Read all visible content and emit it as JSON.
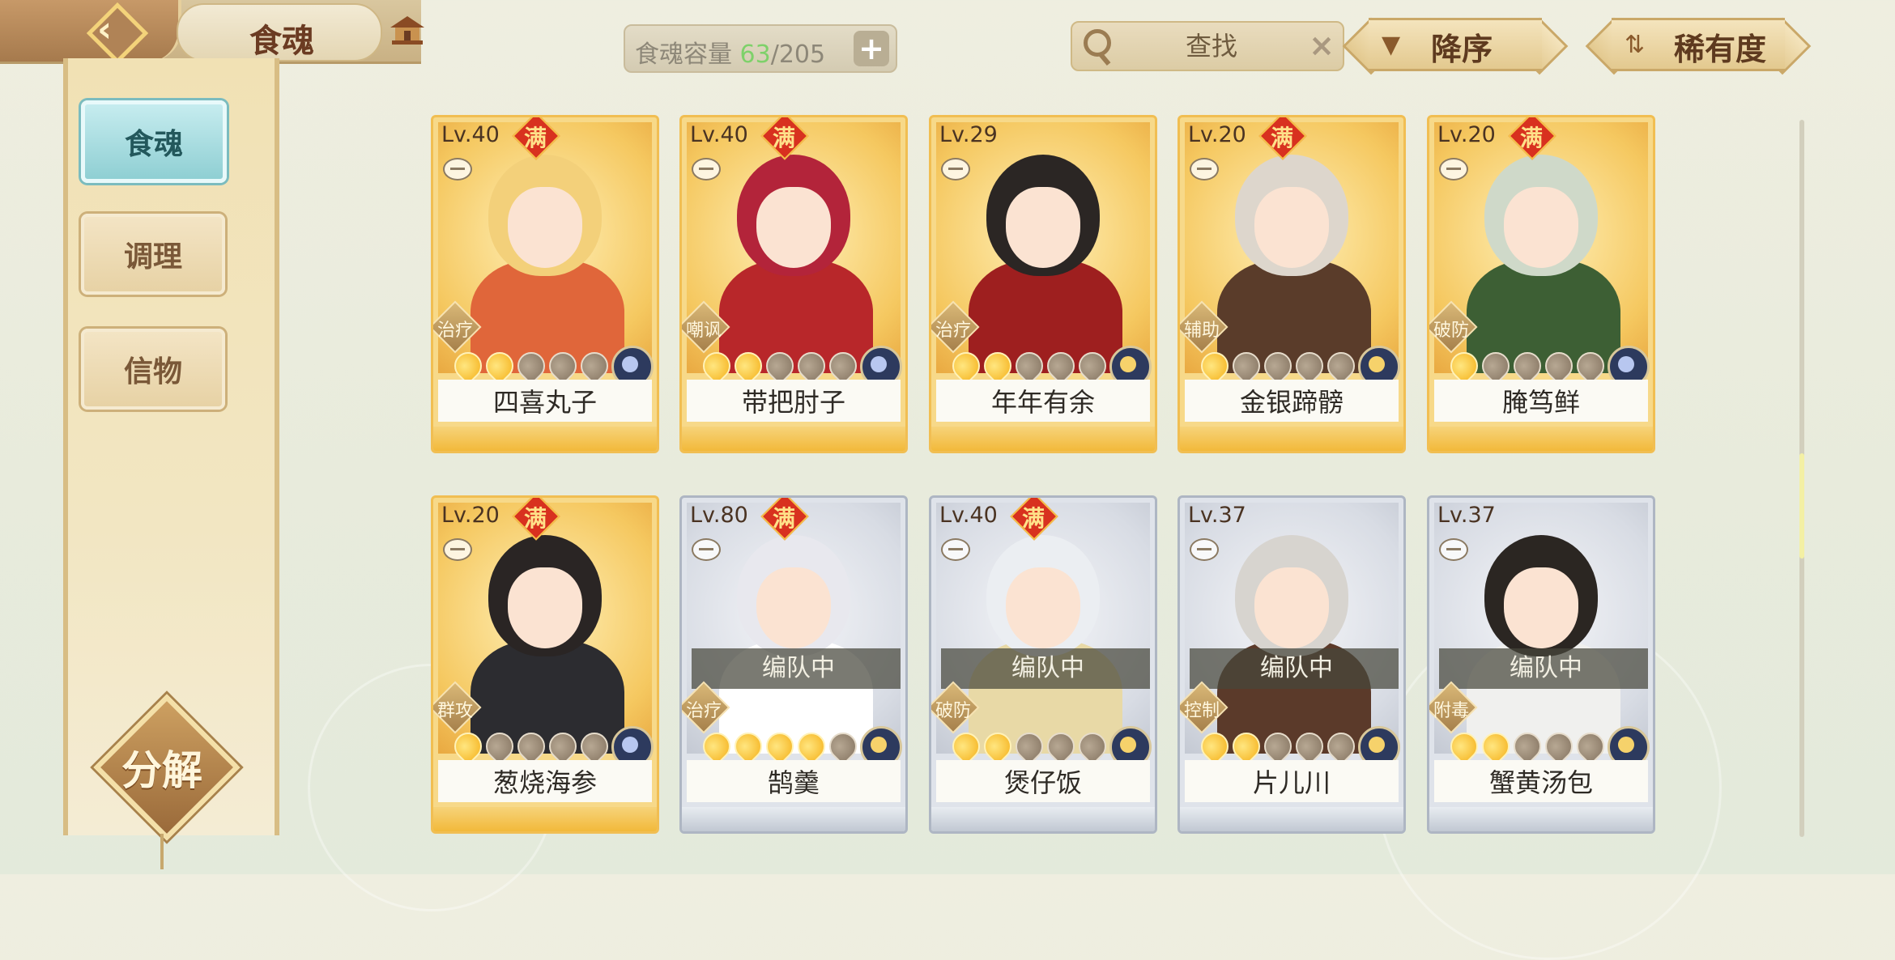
{
  "header": {
    "title": "食魂"
  },
  "sidebar": {
    "items": [
      {
        "label": "食魂",
        "active": true
      },
      {
        "label": "调理",
        "active": false
      },
      {
        "label": "信物",
        "active": false
      }
    ],
    "decompose_label": "分解"
  },
  "capacity": {
    "label": "食魂容量",
    "current": "63",
    "separator": "/",
    "max": "205"
  },
  "search": {
    "placeholder": "查找"
  },
  "sort": {
    "order_label": "降序",
    "rarity_label": "稀有度"
  },
  "cards": [
    {
      "level": "Lv.40",
      "full": true,
      "role": "治疗",
      "stars_on": 2,
      "name": "四喜丸子",
      "in_team": false,
      "rarity": "gold",
      "team_label": ""
    },
    {
      "level": "Lv.40",
      "full": true,
      "role": "嘲讽",
      "stars_on": 2,
      "name": "带把肘子",
      "in_team": false,
      "rarity": "gold",
      "team_label": ""
    },
    {
      "level": "Lv.29",
      "full": false,
      "role": "治疗",
      "stars_on": 2,
      "name": "年年有余",
      "in_team": false,
      "rarity": "gold",
      "team_label": ""
    },
    {
      "level": "Lv.20",
      "full": true,
      "role": "辅助",
      "stars_on": 1,
      "name": "金银蹄髈",
      "in_team": false,
      "rarity": "gold",
      "team_label": ""
    },
    {
      "level": "Lv.20",
      "full": true,
      "role": "破防",
      "stars_on": 1,
      "name": "腌笃鲜",
      "in_team": false,
      "rarity": "gold",
      "team_label": ""
    },
    {
      "level": "Lv.20",
      "full": true,
      "role": "群攻",
      "stars_on": 1,
      "name": "葱烧海参",
      "in_team": false,
      "rarity": "gold",
      "team_label": ""
    },
    {
      "level": "Lv.80",
      "full": true,
      "role": "治疗",
      "stars_on": 4,
      "name": "鹄羹",
      "in_team": true,
      "rarity": "silver",
      "team_label": "编队中"
    },
    {
      "level": "Lv.40",
      "full": true,
      "role": "破防",
      "stars_on": 2,
      "name": "煲仔饭",
      "in_team": true,
      "rarity": "silver",
      "team_label": "编队中"
    },
    {
      "level": "Lv.37",
      "full": false,
      "role": "控制",
      "stars_on": 2,
      "name": "片儿川",
      "in_team": true,
      "rarity": "silver",
      "team_label": "编队中"
    },
    {
      "level": "Lv.37",
      "full": false,
      "role": "附毒",
      "stars_on": 2,
      "name": "蟹黄汤包",
      "in_team": true,
      "rarity": "silver",
      "team_label": "编队中"
    }
  ],
  "full_badge_label": "满",
  "colors": {
    "accent_teal": "#8fcfd3",
    "gold_card": "#f7d989",
    "silver_card": "#dfe3ea",
    "capacity_current": "#7ed16a"
  }
}
